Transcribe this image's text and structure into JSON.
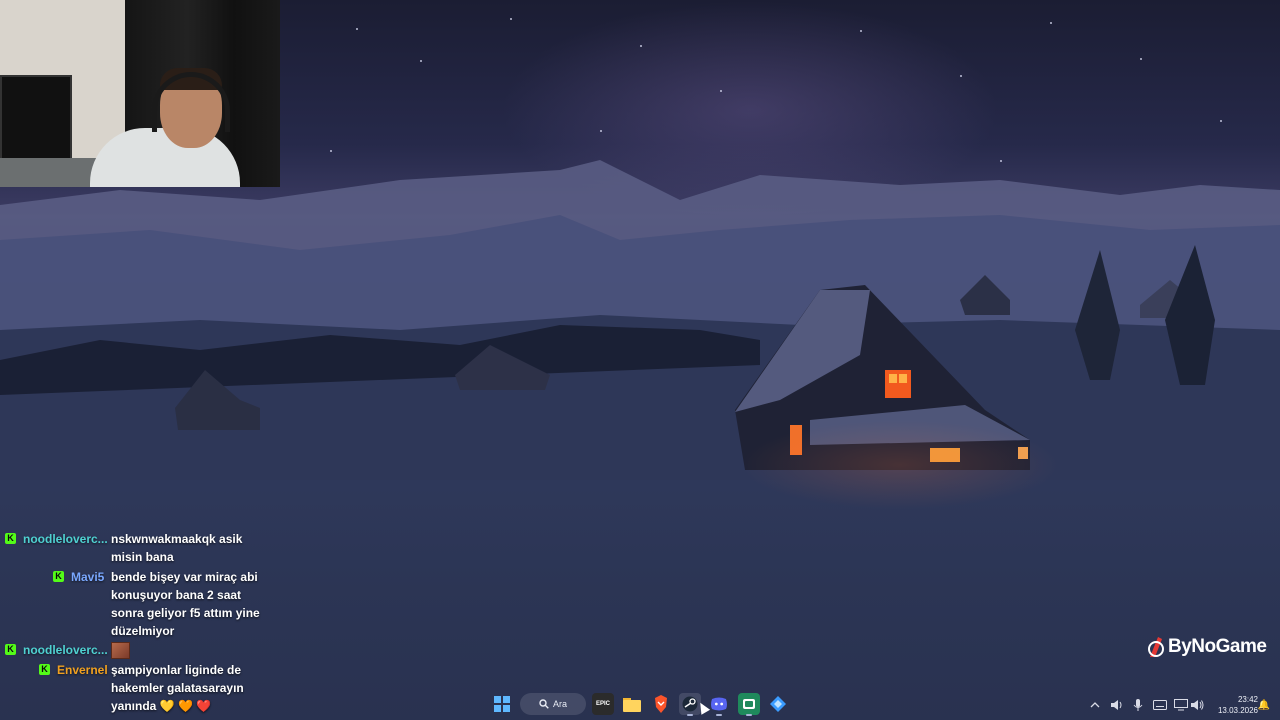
{
  "chat": {
    "messages": [
      {
        "username": "noodleloverc...",
        "username_color": "#4fd1d1",
        "text": "nskwnwakmaakqk asik misin bana"
      },
      {
        "username": "Mavi5",
        "username_color": "#7aa8ff",
        "text": "bende bişey var miraç abi konuşuyor bana 2 saat sonra geliyor f5 attım yine düzelmiyor"
      },
      {
        "username": "noodleloverc...",
        "username_color": "#4fd1d1",
        "text": ""
      },
      {
        "username": "Envernel",
        "username_color": "#f0a020",
        "text": "şampiyonlar liginde de hakemler galatasarayın yanında 💛 🧡 ❤️"
      }
    ],
    "badge_letter": "K",
    "badge_color": "#53fc18"
  },
  "logo": {
    "text": "ByNoGame",
    "accent": "#e53935"
  },
  "taskbar": {
    "search_label": "Ara",
    "icons": [
      "start-icon",
      "search-icon",
      "epic-games-icon",
      "file-explorer-icon",
      "brave-browser-icon",
      "steam-icon",
      "discord-icon",
      "kick-studio-icon",
      "network-app-icon"
    ],
    "tray": [
      "chevron-up-icon",
      "speaker-icon",
      "microphone-icon",
      "keyboard-icon",
      "display-icon",
      "volume-icon"
    ],
    "time": "23:42",
    "date": "13.03.2026",
    "notification": "🔔"
  }
}
